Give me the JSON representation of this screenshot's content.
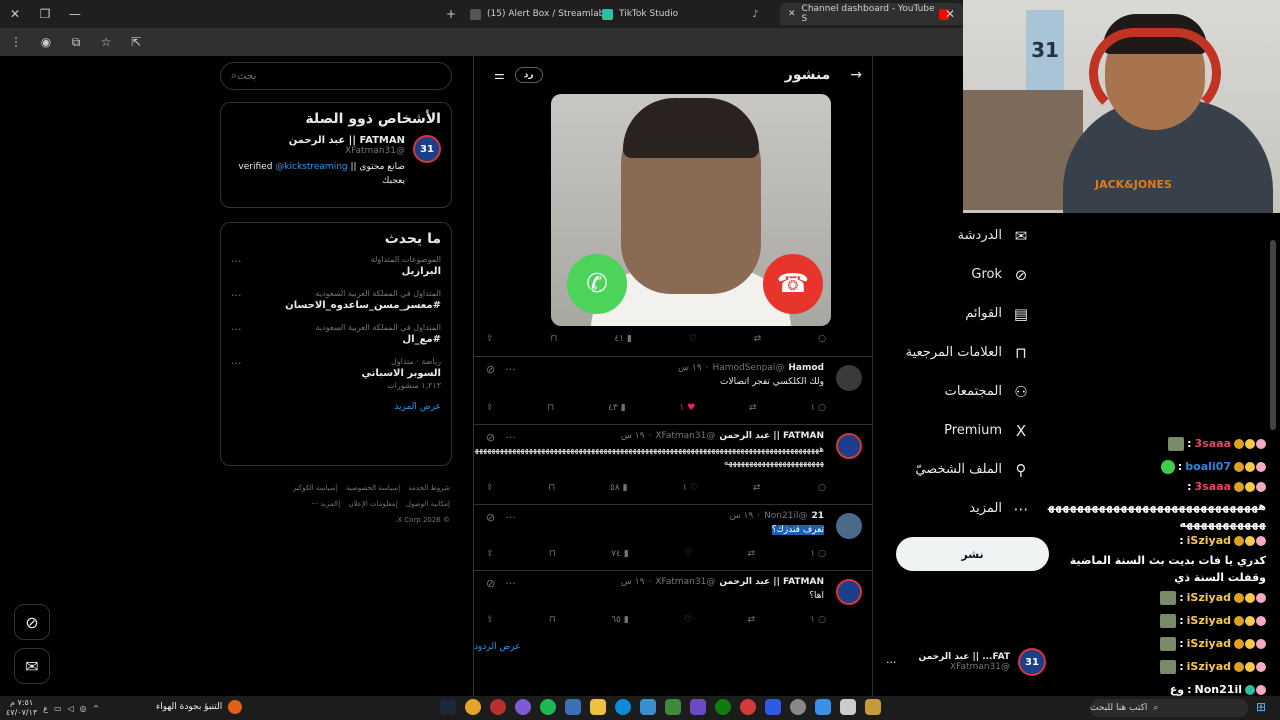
{
  "browser": {
    "tabs": [
      {
        "label": "(15) Alert Box / Streamlabs",
        "color": "#555555"
      },
      {
        "label": "TikTok Studio",
        "color": "#2ac3a2"
      },
      {
        "label": "Channel dashboard - YouTube S",
        "color": "#ff0000"
      }
    ],
    "new_tab": "+",
    "close": "✕"
  },
  "search": {
    "placeholder": "بحث"
  },
  "related": {
    "title": "الأشخاص ذوو الصلة",
    "name": "FATMAN || عبد الرحمن",
    "handle": "@XFatman31",
    "bio_prefix": "صانع محتوى || verified",
    "bio_link": "@kickstreaming",
    "bio_suffix": "يعجبك"
  },
  "trends": {
    "title": "ما يحدث",
    "items": [
      {
        "meta": "الموضوعات المتداولة",
        "name": "البرازيل",
        "count": ""
      },
      {
        "meta": "المتداول في المملكة العربية السعودية",
        "name": "#معسر_مسن_ساعدوه_الاحسان",
        "count": ""
      },
      {
        "meta": "المتداول في المملكة العربية السعودية",
        "name": "#مع_ال",
        "count": ""
      },
      {
        "meta": "رياضة · متداول",
        "name": "السوبر الاسباني",
        "count": "١,٢١٣ منشورات"
      }
    ],
    "show_more": "عرض المزيد"
  },
  "footer": {
    "line1": [
      "شروط الخدمة",
      "سياسة الخصوصية",
      "سياسة الكوكيز"
    ],
    "line2": [
      "إمكانية الوصول",
      "معلومات الإعلان",
      "المزيد ···"
    ],
    "copyright": "© 2026 X Corp."
  },
  "center": {
    "title": "منشور",
    "reply_label": "رد",
    "main_actions": {
      "replies": "",
      "likes": "",
      "views": "٤١"
    },
    "posts": [
      {
        "name": "Hamod",
        "handle": "@HamodSenpai",
        "time": "١٩ س",
        "body": "ولك الكلكسي تفجر اتصالات",
        "replies": "١",
        "likes": "١",
        "views": "٤٣",
        "liked": true,
        "avatar": "#3a3a3a"
      },
      {
        "name": "FATMAN || عبد الرحمن",
        "handle": "@XFatman31",
        "time": "١٩ س",
        "body": "هههههههههههههههههههههههههههههههههههههههههههههههههههههههههههههههههههههههههههههههههههههههههههههههههههههههههههه",
        "replies": "",
        "likes": "١",
        "views": "٥٨",
        "liked": false,
        "avatar": "#1b3f8a"
      },
      {
        "name": "21",
        "handle": "@Non21il",
        "time": "١٩ س",
        "body": "تعرف قندزك؟",
        "replies": "١",
        "likes": "",
        "views": "٧٤",
        "liked": false,
        "avatar": "#4a6a8a"
      },
      {
        "name": "FATMAN || عبد الرحمن",
        "handle": "@XFatman31",
        "time": "١٩ س",
        "body": "اها؟",
        "replies": "١",
        "likes": "",
        "views": "٦٥",
        "liked": false,
        "avatar": "#1b3f8a"
      }
    ],
    "show_replies": "عرض الردود"
  },
  "nav": {
    "items": [
      {
        "label": "الدردشة",
        "icon": "✉"
      },
      {
        "label": "Grok",
        "icon": "⊘"
      },
      {
        "label": "القوائم",
        "icon": "▤"
      },
      {
        "label": "العلامات المرجعية",
        "icon": "⊓"
      },
      {
        "label": "المجتمعات",
        "icon": "⚇"
      },
      {
        "label": "Premium",
        "icon": "X"
      },
      {
        "label": "الملف الشخصيّ",
        "icon": "⚲"
      },
      {
        "label": "المزيد",
        "icon": "⋯"
      }
    ],
    "post_button": "نشر",
    "account": {
      "name": "FAT... || عبد الرحمن",
      "handle": "@XFatman31"
    }
  },
  "webcam": {
    "jersey": "31",
    "shirt_logo": "JACK&JONES"
  },
  "chat": [
    {
      "user": "3saaa",
      "color": "#e94560",
      "text": ""
    },
    {
      "user": "boali07",
      "color": "#2e86de",
      "text": ""
    },
    {
      "user": "3saaa",
      "color": "#e94560",
      "text": "هههههههههههههههههههههههههههههههههههههههههه"
    },
    {
      "user": "iSziyad",
      "color": "#f7c948",
      "text": "كدري يا فات بديت بث السنة الماضية وقفلت السنة ذي"
    },
    {
      "user": "iSziyad",
      "color": "#f7c948",
      "text": ""
    },
    {
      "user": "iSziyad",
      "color": "#f7c948",
      "text": ""
    },
    {
      "user": "iSziyad",
      "color": "#f7c948",
      "text": ""
    },
    {
      "user": "iSziyad",
      "color": "#f7c948",
      "text": ""
    },
    {
      "user": "Non21il",
      "color": "#ffffff",
      "text": "وع"
    },
    {
      "user": "3saaa",
      "color": "#e94560",
      "text": ""
    }
  ],
  "taskbar": {
    "search_placeholder": "اكتب هنا للبحث",
    "weather": "التنبؤ بجودة الهواء",
    "time": "٧:٥١ م",
    "date": "٤٧/٠٧/١٣"
  },
  "colors": {
    "accent": "#1d9bf0",
    "like": "#f91880",
    "bg": "#000000",
    "border": "#2f3336"
  }
}
